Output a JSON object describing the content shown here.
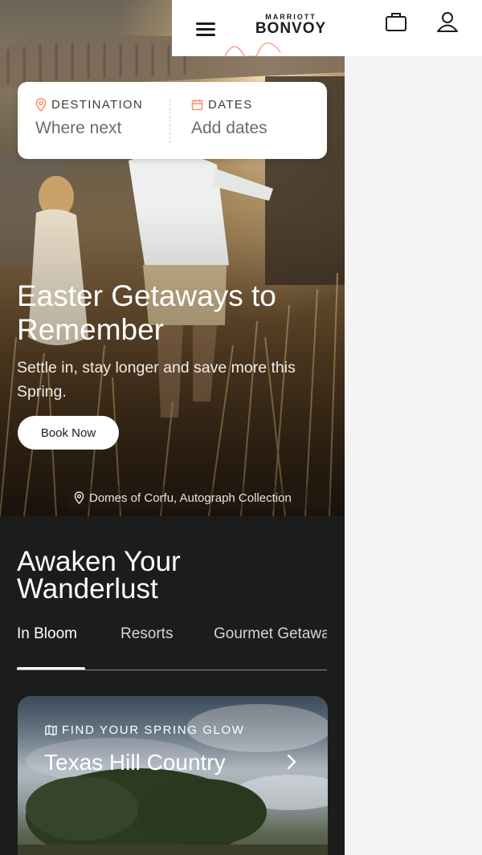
{
  "header": {
    "brand_small": "MARRIOTT",
    "brand_big": "BONVOY",
    "menu_icon": "hamburger-menu-icon",
    "trips_icon": "briefcase-icon",
    "account_icon": "user-icon"
  },
  "search": {
    "destination_label": "DESTINATION",
    "destination_placeholder": "Where next",
    "dates_label": "DATES",
    "dates_placeholder": "Add dates"
  },
  "hero": {
    "title": "Easter Getaways to Remember",
    "subtitle": "Settle in, stay longer and save more this Spring.",
    "cta": "Book Now",
    "location": "Domes of Corfu, Autograph Collection"
  },
  "section": {
    "title": "Awaken Your Wanderlust",
    "tabs": [
      {
        "label": "In Bloom"
      },
      {
        "label": "Resorts"
      },
      {
        "label": "Gourmet Getaways"
      }
    ],
    "card": {
      "kicker": "FIND YOUR SPRING GLOW",
      "title": "Texas Hill Country"
    }
  },
  "colors": {
    "accent": "#ff8d6b",
    "dark_bg": "#1c1c1c",
    "page_bg": "#f4f4f4"
  }
}
